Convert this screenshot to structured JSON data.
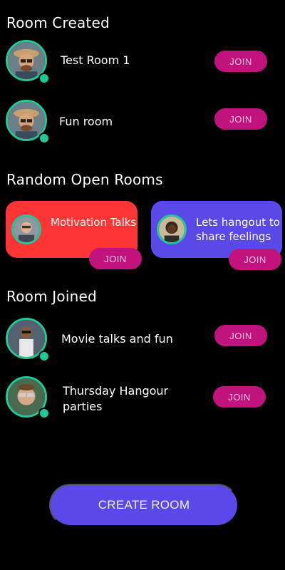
{
  "sections": {
    "room_created": "Room Created",
    "random_open_rooms": "Random Open Rooms",
    "room_joined": "Room Joined"
  },
  "join_label": "JOIN",
  "created_rooms": [
    {
      "name": "Test Room 1"
    },
    {
      "name": "Fun room"
    }
  ],
  "open_rooms": [
    {
      "title": "Motivation Talks",
      "color": "#ff3434"
    },
    {
      "title": "Lets hangout to share feelings",
      "color": "#5a49e8"
    }
  ],
  "joined_rooms": [
    {
      "name": "Movie talks and fun"
    },
    {
      "name": "Thursday Hangour parties"
    }
  ],
  "create_room_label": "CREATE ROOM",
  "colors": {
    "accent_green": "#20c997",
    "join_pink": "#c2127e",
    "primary_purple": "#5a49e8",
    "card_red": "#ff3434"
  }
}
